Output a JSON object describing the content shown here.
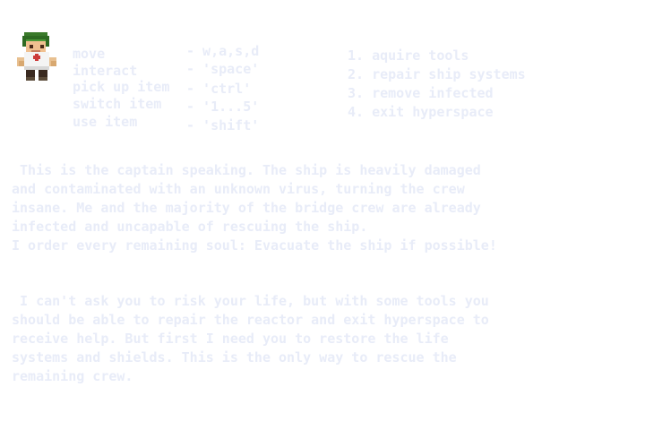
{
  "controls": [
    {
      "action": "move",
      "key": "- w,a,s,d"
    },
    {
      "action": "interact",
      "key": "- 'space'"
    },
    {
      "action": "pick up item",
      "key": "- 'ctrl'"
    },
    {
      "action": "switch item",
      "key": "- '1...5'"
    },
    {
      "action": "use item",
      "key": "- 'shift'"
    }
  ],
  "objectives": [
    "1. aquire tools",
    "2. repair ship systems",
    "3. remove infected",
    "4. exit hyperspace"
  ],
  "message_1": [
    " This is the captain speaking. The ship is heavily damaged",
    "and contaminated with an unknown virus, turning the crew",
    "insane. Me and the majority of the bridge crew are already",
    "infected and uncapable of rescuing the ship.",
    "I order every remaining soul: Evacuate the ship if possible!"
  ],
  "message_2": [
    " I can't ask you to risk your life, but with some tools you",
    "should be able to repair the reactor and exit hyperspace to",
    "receive help. But first I need you to restore the life",
    "systems and shields. This is the only way to rescue the",
    "remaining crew."
  ],
  "colors": {
    "text": "#e8ecf8",
    "background": "#ffffff"
  },
  "icons": {
    "captain": "captain-sprite"
  }
}
